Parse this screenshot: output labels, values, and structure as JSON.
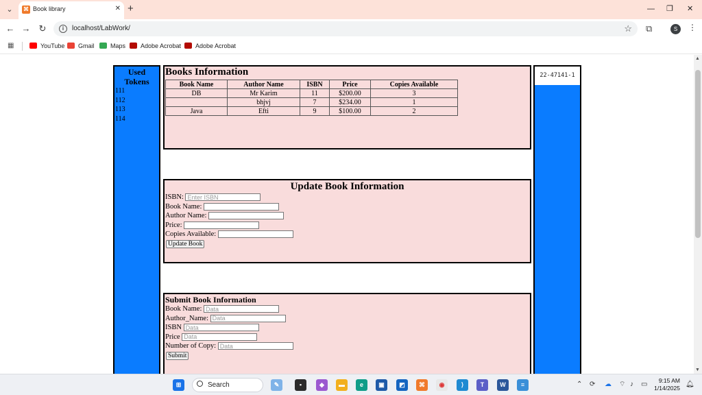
{
  "browser": {
    "tab_title": "Book library",
    "url": "localhost/LabWork/",
    "profile_initial": "S",
    "bookmarks": [
      {
        "label": "YouTube",
        "icon": "youtube-icon",
        "color": "#ff0000"
      },
      {
        "label": "Gmail",
        "icon": "gmail-icon",
        "color": "#ea4335"
      },
      {
        "label": "Maps",
        "icon": "maps-icon",
        "color": "#34a853"
      },
      {
        "label": "Adobe Acrobat",
        "icon": "acrobat-icon",
        "color": "#b30b00"
      },
      {
        "label": "Adobe Acrobat",
        "icon": "acrobat-icon",
        "color": "#b30b00"
      }
    ]
  },
  "sidebar": {
    "title_line1": "Used",
    "title_line2": "Tokens",
    "tokens": [
      "111",
      "112",
      "113",
      "114"
    ]
  },
  "books": {
    "title": "Books Information",
    "headers": [
      "Book Name",
      "Author Name",
      "ISBN",
      "Price",
      "Copies Available"
    ],
    "rows": [
      [
        "DB",
        "Mr Karim",
        "11",
        "$200.00",
        "3"
      ],
      [
        "",
        "bhjvj",
        "7",
        "$234.00",
        "1"
      ],
      [
        "Java",
        "Efti",
        "9",
        "$100.00",
        "2"
      ]
    ]
  },
  "update_form": {
    "title": "Update Book Information",
    "isbn_label": "ISBN:",
    "isbn_placeholder": "Enter ISBN",
    "book_name_label": "Book Name:",
    "author_label": "Author Name:",
    "price_label": "Price:",
    "copies_label": "Copies Available:",
    "button": "Update Book"
  },
  "submit_form": {
    "title": "Submit Book Information",
    "book_name_label": "Book Name:",
    "author_label": "Author_Name:",
    "isbn_label": "ISBN",
    "price_label": "Price",
    "copies_label": "Number of Copy:",
    "placeholder": "Data",
    "button": "Submit"
  },
  "right_panel": {
    "user_id": "22-47141-1"
  },
  "colors": {
    "sidebar_blue": "#0a7cff",
    "panel_pink": "#f9dcdc",
    "chrome_peach": "#fde2d9"
  },
  "taskbar": {
    "search_label": "Search",
    "time": "9:15 AM",
    "date": "1/14/2025"
  }
}
